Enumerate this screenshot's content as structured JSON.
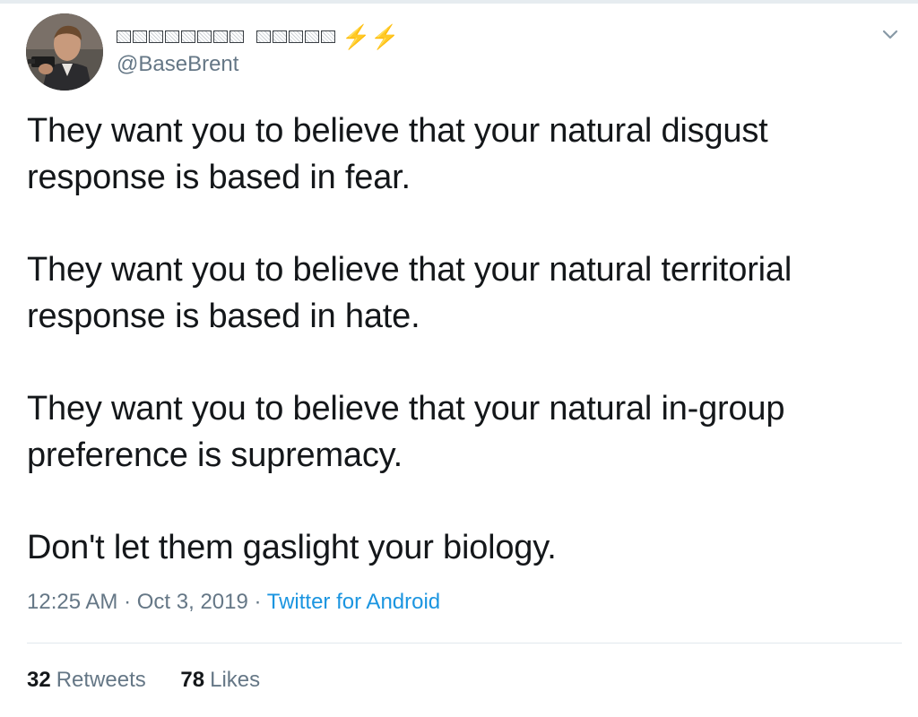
{
  "author": {
    "display_name_emoji": "⚡⚡",
    "handle": "@BaseBrent",
    "avatar_icon": "profile-photo-man-with-gun"
  },
  "tweet": {
    "paragraphs": [
      "They want you to believe that your natural disgust response is based in fear.",
      "They want you to believe that your natural territorial response is based in hate.",
      "They want you to believe that your natural in-group preference is supremacy.",
      "Don't let them gaslight your biology."
    ],
    "time": "12:25 AM",
    "date": "Oct 3, 2019",
    "separator": "·",
    "source": "Twitter for Android"
  },
  "stats": {
    "retweets_count": "32",
    "retweets_label": "Retweets",
    "likes_count": "78",
    "likes_label": "Likes"
  },
  "colors": {
    "text": "#14171a",
    "secondary": "#657786",
    "link": "#1b95e0",
    "bolt": "#f7a81b"
  }
}
